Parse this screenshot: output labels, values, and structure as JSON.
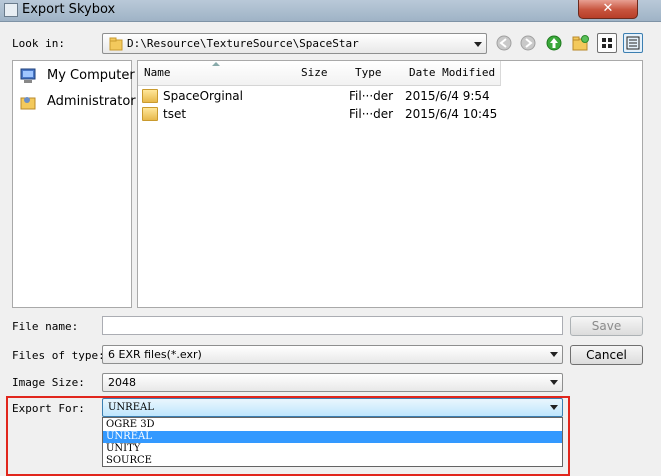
{
  "window": {
    "title": "Export Skybox",
    "close_glyph": "✕"
  },
  "lookin": {
    "label": "Look in:",
    "path": "D:\\Resource\\TextureSource\\SpaceStar"
  },
  "places": [
    {
      "label": "My Computer",
      "icon": "computer-icon"
    },
    {
      "label": "Administrator",
      "icon": "user-folder-icon"
    }
  ],
  "files": {
    "columns": [
      "Name",
      "Size",
      "Type",
      "Date Modified"
    ],
    "rows": [
      {
        "name": "SpaceOrginal",
        "size": "",
        "type": "Fil···der",
        "date": "2015/6/4 9:54"
      },
      {
        "name": "tset",
        "size": "",
        "type": "Fil···der",
        "date": "2015/6/4 10:45"
      }
    ]
  },
  "filename": {
    "label": "File name:",
    "value": ""
  },
  "filetype": {
    "label": "Files of type:",
    "value": "6 EXR files(*.exr)"
  },
  "imagesize": {
    "label": "Image Size:",
    "value": "2048"
  },
  "exportfor": {
    "label": "Export For:",
    "value": "UNREAL",
    "options": [
      "OGRE 3D",
      "UNREAL",
      "UNITY",
      "SOURCE"
    ],
    "selected_index": 1
  },
  "buttons": {
    "save": "Save",
    "cancel": "Cancel"
  },
  "colors": {
    "highlight": "#3399ff",
    "annotation_box": "#e1261c"
  }
}
